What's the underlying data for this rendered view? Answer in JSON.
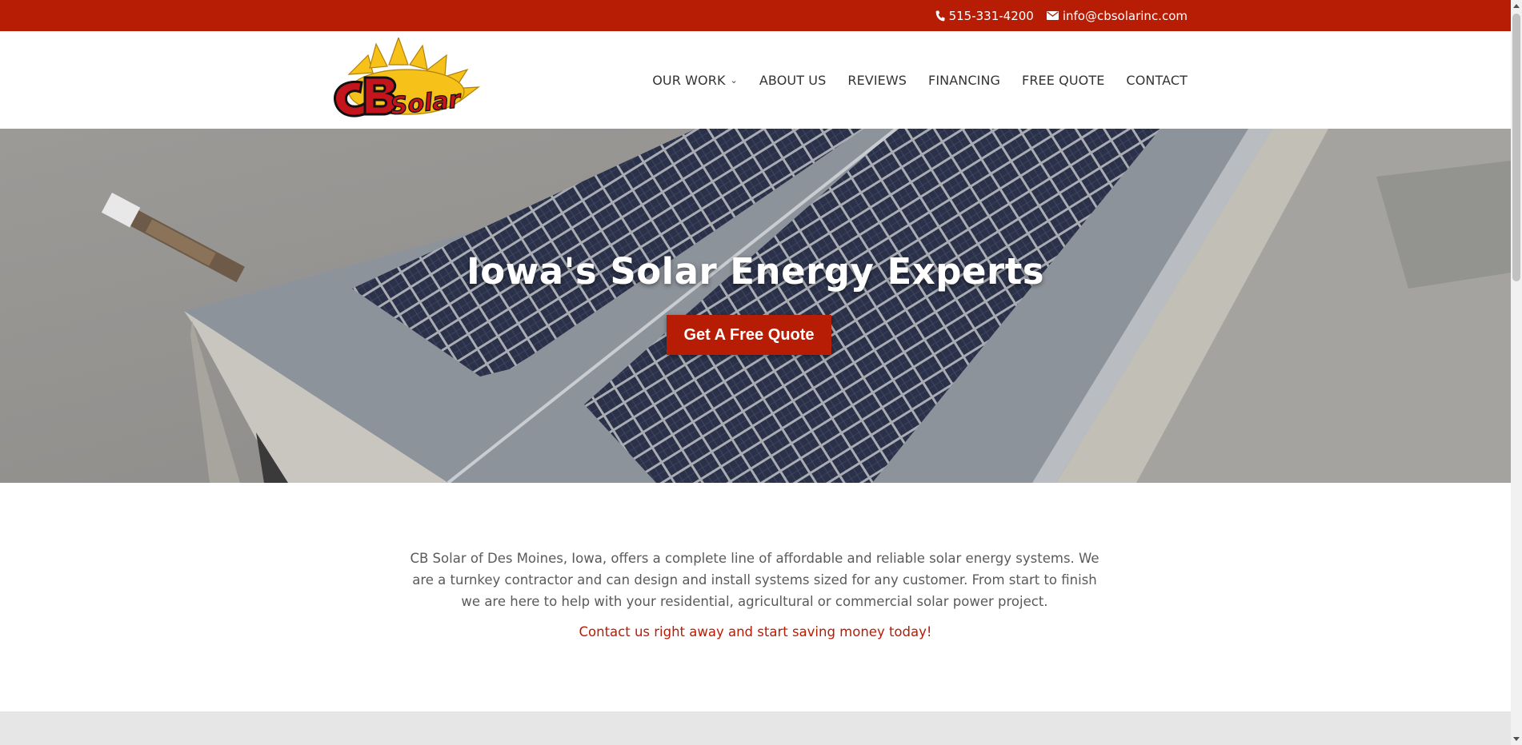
{
  "top_bar": {
    "phone": "515-331-4200",
    "email": "info@cbsolarinc.com",
    "background": "#b71c05"
  },
  "header": {
    "logo": {
      "line1": "CB",
      "line2": "Solar"
    },
    "nav": [
      {
        "label": "OUR WORK",
        "has_dropdown": true
      },
      {
        "label": "ABOUT US"
      },
      {
        "label": "REVIEWS"
      },
      {
        "label": "FINANCING"
      },
      {
        "label": "FREE QUOTE"
      },
      {
        "label": "CONTACT"
      }
    ]
  },
  "hero": {
    "title": "Iowa's Solar Energy Experts",
    "button": "Get A Free Quote"
  },
  "intro": {
    "text": "CB Solar of Des Moines, Iowa, offers a complete line of affordable and reliable solar energy systems. We are a turnkey contractor and can design and install systems sized for any customer. From start to finish we are here to help with your residential, agricultural or commercial solar power project.",
    "cta": "Contact us right away and start saving money today!"
  },
  "colors": {
    "accent": "#b71c05",
    "nav_text": "#333333",
    "body_text": "#5a5a5a"
  }
}
